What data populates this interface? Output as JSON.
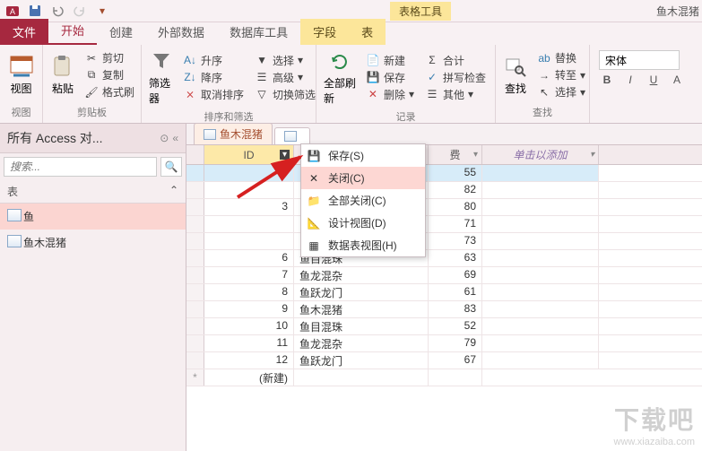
{
  "title_bar": {
    "context_tab_title": "表格工具",
    "filename": "鱼木混猪"
  },
  "ribbon_tabs": {
    "file": "文件",
    "tabs": [
      "开始",
      "创建",
      "外部数据",
      "数据库工具",
      "字段",
      "表"
    ],
    "active_index": 0
  },
  "ribbon": {
    "view": {
      "label": "视图",
      "btn": "视图"
    },
    "clipboard": {
      "label": "剪贴板",
      "paste": "粘贴",
      "cut": "剪切",
      "copy": "复制",
      "format_painter": "格式刷"
    },
    "sort_filter": {
      "label": "排序和筛选",
      "filter": "筛选器",
      "asc": "升序",
      "desc": "降序",
      "remove_sort": "取消排序",
      "selection": "选择",
      "advanced": "高级",
      "toggle_filter": "切换筛选"
    },
    "records": {
      "label": "记录",
      "refresh_all": "全部刷新",
      "new": "新建",
      "save": "保存",
      "delete": "删除",
      "totals": "合计",
      "spelling": "拼写检查",
      "more": "其他"
    },
    "find": {
      "label": "查找",
      "find": "查找",
      "replace": "替换",
      "goto": "转至",
      "select": "选择"
    },
    "font_value": "宋体",
    "bold": "B",
    "italic": "I",
    "underline": "U",
    "font_a": "A"
  },
  "navpane": {
    "title": "所有 Access 对...",
    "search_placeholder": "搜索...",
    "section": "表",
    "items": [
      "鱼",
      "鱼木混猪"
    ],
    "selected_index": 0
  },
  "doc_tabs": {
    "tabs": [
      "鱼木混猪",
      ""
    ],
    "active_index": 0
  },
  "grid": {
    "columns": {
      "id": "ID",
      "add": "单击以添加"
    },
    "rows": [
      {
        "id": "",
        "f2": "",
        "f3": 55,
        "sel": true
      },
      {
        "id": "",
        "f2": "",
        "f3": 82
      },
      {
        "id": 3,
        "f2": "",
        "f3": 80
      },
      {
        "id": "",
        "f2": "",
        "f3": 71
      },
      {
        "id": "",
        "f2": "",
        "f3": 73
      },
      {
        "id": 6,
        "f2": "鱼目混珠",
        "f3": 63
      },
      {
        "id": 7,
        "f2": "鱼龙混杂",
        "f3": 69
      },
      {
        "id": 8,
        "f2": "鱼跃龙门",
        "f3": 61
      },
      {
        "id": 9,
        "f2": "鱼木混猪",
        "f3": 83
      },
      {
        "id": 10,
        "f2": "鱼目混珠",
        "f3": 52
      },
      {
        "id": 11,
        "f2": "鱼龙混杂",
        "f3": 79
      },
      {
        "id": 12,
        "f2": "鱼跃龙门",
        "f3": 67
      }
    ],
    "new_row_label": "(新建)",
    "new_row_marker": "*",
    "hidden_col_marker": "费"
  },
  "context_menu": {
    "items": [
      {
        "label": "保存(S)",
        "icon": "save"
      },
      {
        "label": "关闭(C)",
        "icon": "close",
        "hover": true
      },
      {
        "label": "全部关闭(C)",
        "icon": "folder"
      },
      {
        "label": "设计视图(D)",
        "icon": "design"
      },
      {
        "label": "数据表视图(H)",
        "icon": "datasheet"
      }
    ]
  },
  "watermark": {
    "big": "下载吧",
    "url": "www.xiazaiba.com"
  },
  "colors": {
    "accent": "#a6283f",
    "tab_context_bg": "#fce69a",
    "sel_row": "#d7ecf9",
    "nav_sel": "#fbd5d1",
    "menu_hover": "#fdd7d3"
  }
}
